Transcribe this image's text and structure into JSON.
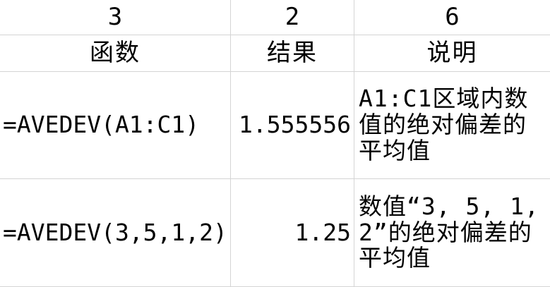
{
  "sheet": {
    "row1": {
      "a": "3",
      "b": "2",
      "c": "6"
    },
    "row2": {
      "a": "函数",
      "b": "结果",
      "c": "说明"
    },
    "row3": {
      "formula": "=AVEDEV(A1:C1)",
      "result": "1.555556",
      "description": "A1:C1区域内数值的绝对偏差的平均值"
    },
    "row4": {
      "formula": "=AVEDEV(3,5,1,2)",
      "result": "1.25",
      "description": "数值“3, 5, 1, 2”的绝对偏差的平均值"
    }
  }
}
